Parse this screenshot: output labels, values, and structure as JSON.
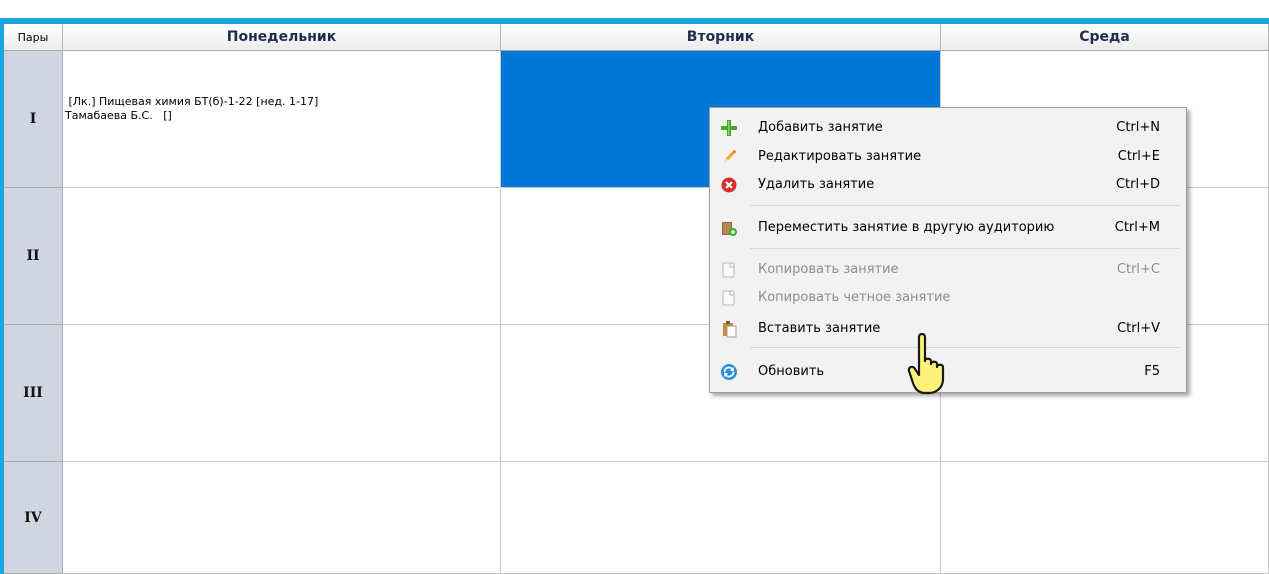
{
  "grid": {
    "corner_label": "Пары",
    "days": [
      "Понедельник",
      "Вторник",
      "Среда"
    ],
    "pairs": [
      "I",
      "II",
      "III",
      "IV"
    ],
    "lesson": {
      "line1": " [Лк.] Пищевая химия БТ(б)-1-22 [нед. 1-17]",
      "line2": "Тамабаева Б.С.   []"
    },
    "selected_color": "#0078d7"
  },
  "context_menu": {
    "items": [
      {
        "label": "Добавить занятие",
        "shortcut": "Ctrl+N",
        "icon": "plus-icon",
        "enabled": true
      },
      {
        "label": "Редактировать занятие",
        "shortcut": "Ctrl+E",
        "icon": "pencil-icon",
        "enabled": true
      },
      {
        "label": "Удалить занятие",
        "shortcut": "Ctrl+D",
        "icon": "delete-icon",
        "enabled": true
      },
      {
        "label": "Переместить занятие в другую аудиторию",
        "shortcut": "Ctrl+M",
        "icon": "move-icon",
        "enabled": true
      },
      {
        "label": "Копировать занятие",
        "shortcut": "Ctrl+C",
        "icon": "copy-icon",
        "enabled": false
      },
      {
        "label": "Копировать четное занятие",
        "shortcut": "",
        "icon": "copy-even-icon",
        "enabled": false
      },
      {
        "label": "Вставить занятие",
        "shortcut": "Ctrl+V",
        "icon": "paste-icon",
        "enabled": true
      },
      {
        "label": "Обновить",
        "shortcut": "F5",
        "icon": "refresh-icon",
        "enabled": true
      }
    ]
  },
  "colors": {
    "accent": "#1aa5e0",
    "header_text": "#1f2d4d",
    "pair_bg": "#cfd6e2"
  }
}
